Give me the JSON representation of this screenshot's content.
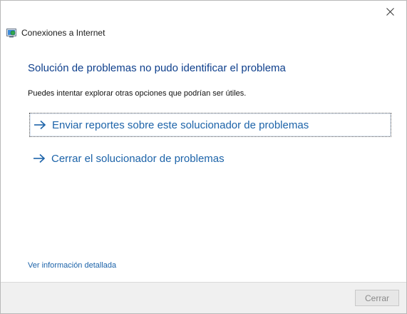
{
  "window": {
    "title": "Conexiones a Internet",
    "close_icon": "close-icon"
  },
  "main": {
    "heading": "Solución de problemas no pudo identificar el problema",
    "subtext": "Puedes intentar explorar otras opciones que podrían ser útiles.",
    "options": [
      {
        "label": "Enviar reportes sobre este solucionador de problemas",
        "icon": "arrow-right-icon",
        "focused": true
      },
      {
        "label": "Cerrar el solucionador de problemas",
        "icon": "arrow-right-icon",
        "focused": false
      }
    ],
    "details_link": "Ver información detallada"
  },
  "footer": {
    "cancel_label": "Cerrar",
    "cancel_enabled": false
  },
  "colors": {
    "heading": "#0e3f8c",
    "link": "#1c63a9"
  }
}
